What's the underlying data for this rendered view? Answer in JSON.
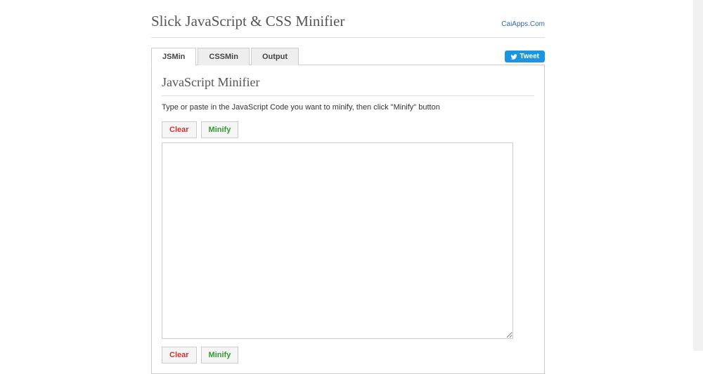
{
  "header": {
    "title": "Slick JavaScript & CSS Minifier",
    "link_text": "CaiApps.Com"
  },
  "tabs": [
    {
      "label": "JSMin",
      "active": true
    },
    {
      "label": "CSSMin",
      "active": false
    },
    {
      "label": "Output",
      "active": false
    }
  ],
  "tweet": {
    "label": "Tweet"
  },
  "panel": {
    "title": "JavaScript Minifier",
    "description": "Type or paste in the JavaScript Code you want to minify, then click \"Minify\" button",
    "clear_label": "Clear",
    "minify_label": "Minify",
    "textarea_value": ""
  }
}
